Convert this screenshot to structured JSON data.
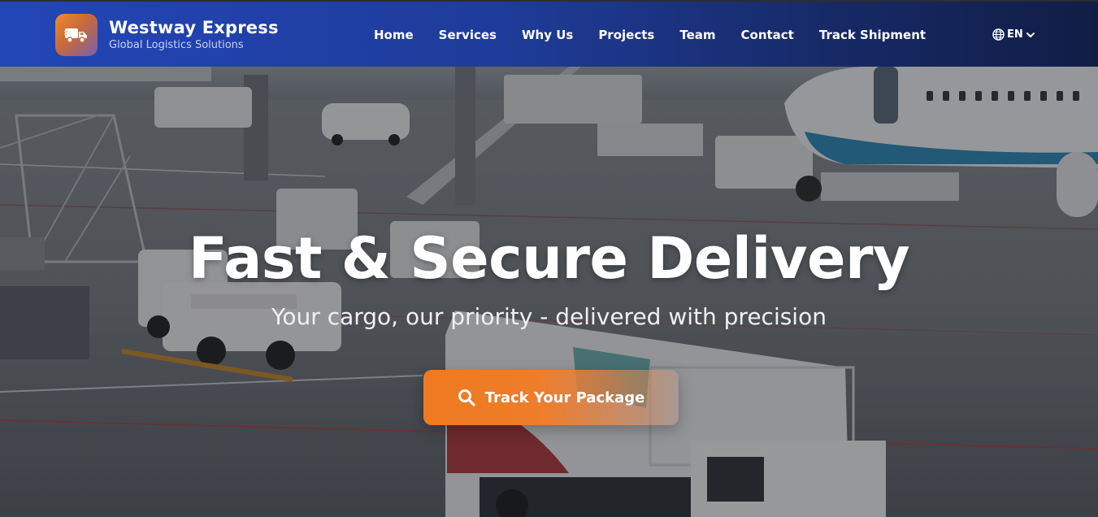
{
  "brand": {
    "name": "Westway Express",
    "tagline": "Global Logistics Solutions",
    "logo_icon": "truck-icon"
  },
  "nav": {
    "links": [
      "Home",
      "Services",
      "Why Us",
      "Projects",
      "Team",
      "Contact",
      "Track Shipment"
    ]
  },
  "language": {
    "label": "EN",
    "icon": "globe-icon",
    "dropdown_icon": "chevron-down-icon"
  },
  "hero": {
    "title": "Fast & Secure Delivery",
    "subtitle": "Your cargo, our priority - delivered with precision",
    "cta_label": "Track Your Package",
    "cta_icon": "search-icon",
    "background": "airport-apron-photo"
  },
  "colors": {
    "nav_start": "#2346b7",
    "nav_end": "#111d45",
    "accent_orange": "#ef7a1f",
    "text_white": "#ffffff"
  }
}
